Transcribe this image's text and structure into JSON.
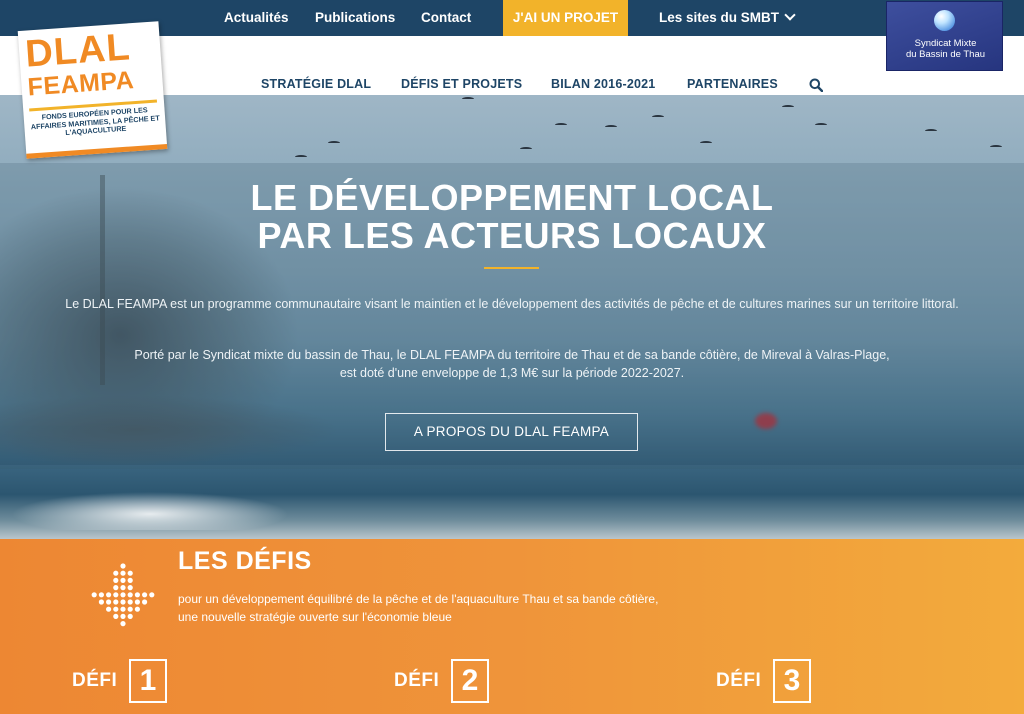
{
  "topnav": {
    "items": [
      {
        "label": "Actualités"
      },
      {
        "label": "Publications"
      },
      {
        "label": "Contact"
      },
      {
        "label": "J'AI UN PROJET"
      },
      {
        "label": "Les sites du SMBT"
      }
    ],
    "projet_color": "#f2b32a",
    "bar_color": "#1e4566"
  },
  "smbt_logo": {
    "line1": "Syndicat Mixte",
    "line2": "du Bassin de Thau"
  },
  "dlal_logo": {
    "line1": "DLAL",
    "line2": "FEAMPA",
    "subtitle": "FONDS EUROPÉEN POUR LES AFFAIRES MARITIMES, LA PÊCHE ET L'AQUACULTURE"
  },
  "mainnav": {
    "items": [
      {
        "label": "STRATÉGIE DLAL"
      },
      {
        "label": "DÉFIS ET PROJETS"
      },
      {
        "label": "BILAN 2016-2021"
      },
      {
        "label": "PARTENAIRES"
      }
    ],
    "search_icon": "search-icon"
  },
  "hero": {
    "title_line1": "LE DÉVELOPPEMENT LOCAL",
    "title_line2": "PAR LES ACTEURS LOCAUX",
    "paragraph1": "Le DLAL FEAMPA est un programme communautaire visant le maintien et le développement des activités de pêche et de cultures marines sur un territoire littoral.",
    "paragraph2_line1": "Porté par le Syndicat mixte du bassin de Thau, le DLAL FEAMPA du territoire de Thau et de sa bande côtière,  de Mireval à Valras-Plage,",
    "paragraph2_line2": "est doté d'une enveloppe de 1,3 M€ sur la période 2022-2027.",
    "button_label": "A PROPOS DU DLAL FEAMPA",
    "accent_color": "#f2b32a"
  },
  "defis": {
    "title": "LES DÉFIS",
    "subtitle_line1": "pour un développement équilibré de la pêche et de l'aquaculture Thau et sa bande côtière,",
    "subtitle_line2": "une nouvelle stratégie ouverte sur l'économie bleue",
    "icon": "dotted-arrow-down-icon",
    "items": [
      {
        "label": "DÉFI",
        "number": "1"
      },
      {
        "label": "DÉFI",
        "number": "2"
      },
      {
        "label": "DÉFI",
        "number": "3"
      }
    ],
    "background_color": "#ef943a"
  }
}
